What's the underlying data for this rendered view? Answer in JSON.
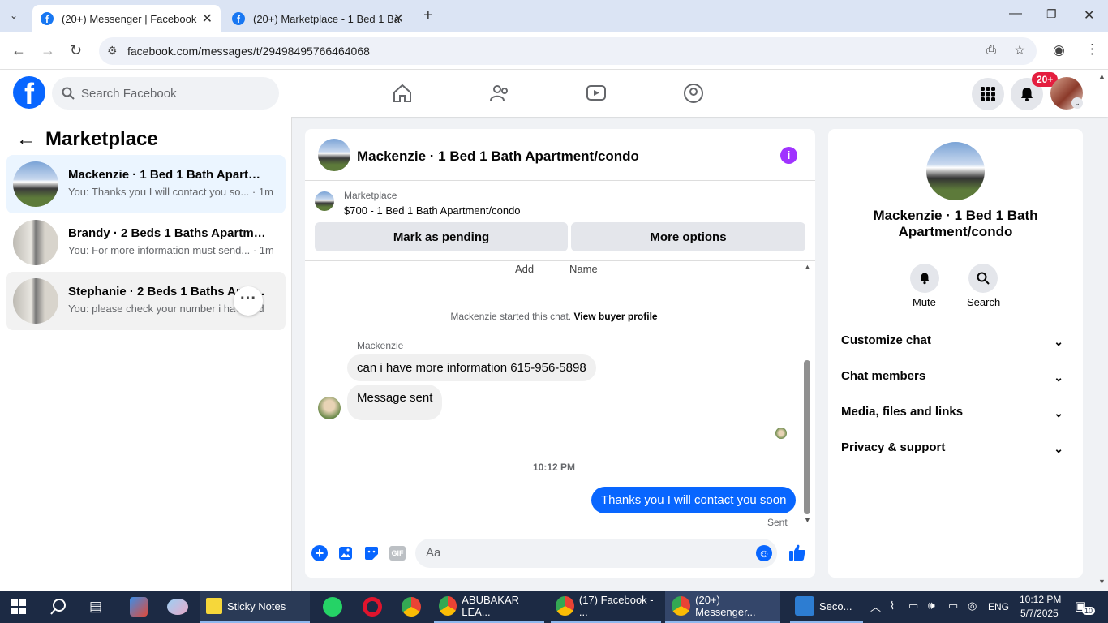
{
  "browser": {
    "tabs": [
      {
        "label": "(20+) Messenger | Facebook"
      },
      {
        "label": "(20+) Marketplace - 1 Bed 1 Ba"
      }
    ],
    "url": "facebook.com/messages/t/29498495766464068"
  },
  "facebook": {
    "search_placeholder": "Search Facebook",
    "notification_badge": "20+"
  },
  "left_panel": {
    "title": "Marketplace",
    "conversations": [
      {
        "name": "Mackenzie · 1 Bed 1 Bath Apartme...",
        "preview": "You: Thanks you I will contact you so... · 1m"
      },
      {
        "name": "Brandy · 2 Beds 1 Baths Apartment...",
        "preview": "You: For more information must send... · 1m"
      },
      {
        "name": "Stephanie · 2 Beds 1 Baths Apar...",
        "preview": "You: please check your number i have ...d"
      }
    ]
  },
  "chat": {
    "title": "Mackenzie · 1 Bed 1 Bath Apartment/condo",
    "listing_source": "Marketplace",
    "listing_title": "$700 - 1 Bed 1 Bath Apartment/condo",
    "mark_pending_label": "Mark as pending",
    "more_options_label": "More options",
    "partial_add": "Add",
    "partial_name": "Name",
    "started_text": "Mackenzie started this chat.",
    "view_profile": "View buyer profile",
    "sender_name": "Mackenzie",
    "messages": [
      {
        "text": "can i have more information 615-956-5898"
      },
      {
        "text": "Message sent"
      }
    ],
    "timestamp": "10:12 PM",
    "my_message": "Thanks you I will contact you soon",
    "status": "Sent",
    "input_placeholder": "Aa"
  },
  "right_panel": {
    "name": "Mackenzie · 1 Bed 1 Bath Apartment/condo",
    "mute_label": "Mute",
    "search_label": "Search",
    "sections": [
      {
        "label": "Customize chat"
      },
      {
        "label": "Chat members"
      },
      {
        "label": "Media, files and links"
      },
      {
        "label": "Privacy & support"
      }
    ]
  },
  "taskbar": {
    "items": [
      {
        "label": "Sticky Notes"
      },
      {
        "label": "ABUBAKAR LEA..."
      },
      {
        "label": "(17) Facebook - ..."
      },
      {
        "label": "(20+) Messenger..."
      },
      {
        "label": "Seco..."
      }
    ],
    "language": "ENG",
    "time": "10:12 PM",
    "date": "5/7/2025",
    "notif_count": "10"
  },
  "colors": {
    "fb_blue": "#0866ff",
    "accent_purple": "#a033ff"
  }
}
